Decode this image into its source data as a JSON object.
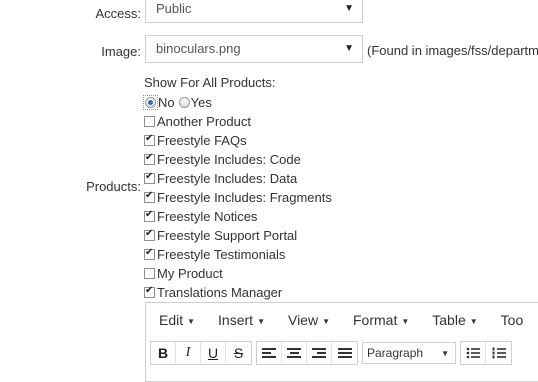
{
  "access": {
    "label": "Access:",
    "value": "Public"
  },
  "image": {
    "label": "Image:",
    "value": "binoculars.png",
    "note": "(Found in images/fss/departm"
  },
  "products": {
    "label": "Products:",
    "heading": "Show For All Products:",
    "radio_no": "No",
    "radio_yes": "Yes",
    "selected": "No",
    "items": [
      {
        "label": "Another Product",
        "checked": false
      },
      {
        "label": "Freestyle FAQs",
        "checked": true
      },
      {
        "label": "Freestyle Includes: Code",
        "checked": true
      },
      {
        "label": "Freestyle Includes: Data",
        "checked": true
      },
      {
        "label": "Freestyle Includes: Fragments",
        "checked": true
      },
      {
        "label": "Freestyle Notices",
        "checked": true
      },
      {
        "label": "Freestyle Support Portal",
        "checked": true
      },
      {
        "label": "Freestyle Testimonials",
        "checked": true
      },
      {
        "label": "My Product",
        "checked": false
      },
      {
        "label": "Translations Manager",
        "checked": true
      }
    ]
  },
  "editor": {
    "menus": [
      "Edit",
      "Insert",
      "View",
      "Format",
      "Table",
      "Too"
    ],
    "format_select": "Paragraph",
    "buttons": {
      "bold": "B",
      "italic": "I",
      "underline": "U",
      "strike": "S"
    }
  },
  "icons": {
    "caret": "▼"
  }
}
